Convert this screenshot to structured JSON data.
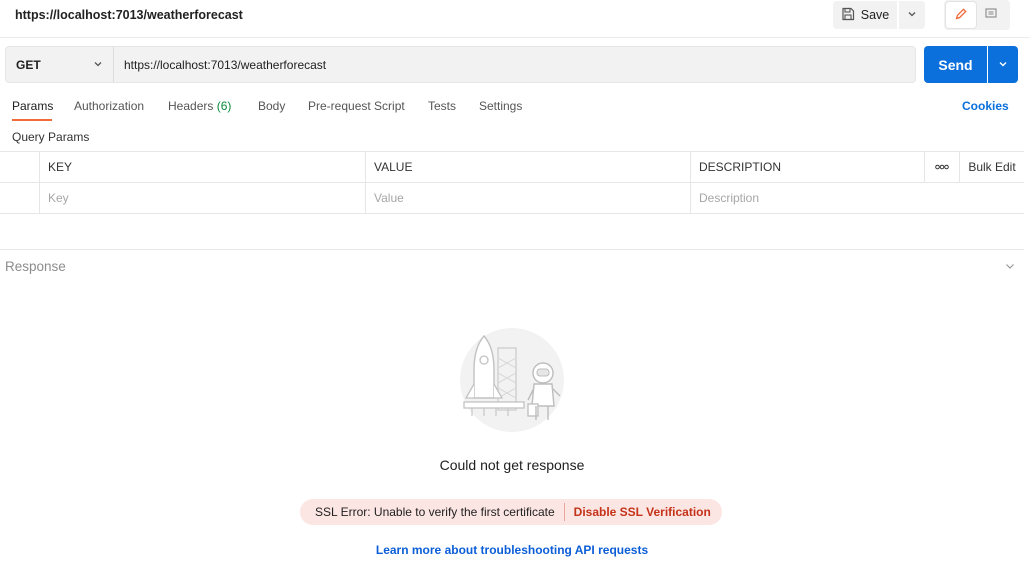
{
  "header": {
    "title": "https://localhost:7013/weatherforecast",
    "save_label": "Save"
  },
  "request": {
    "method": "GET",
    "url": "https://localhost:7013/weatherforecast",
    "send_label": "Send"
  },
  "tabs": {
    "params": "Params",
    "authorization": "Authorization",
    "headers": "Headers",
    "headers_count": "(6)",
    "body": "Body",
    "prerequest": "Pre-request Script",
    "tests": "Tests",
    "settings": "Settings",
    "cookies": "Cookies"
  },
  "params": {
    "section_label": "Query Params",
    "columns": {
      "key": "KEY",
      "value": "VALUE",
      "description": "DESCRIPTION",
      "more": "ooo",
      "bulk_edit": "Bulk Edit"
    },
    "placeholders": {
      "key": "Key",
      "value": "Value",
      "description": "Description"
    }
  },
  "response": {
    "title": "Response",
    "empty_message": "Could not get response",
    "error_text": "SSL Error: Unable to verify the first certificate",
    "disable_ssl_label": "Disable SSL Verification",
    "learn_more": "Learn more about troubleshooting API requests"
  },
  "colors": {
    "accent": "#f26b3a",
    "send": "#0b6fdc",
    "error_bg": "#fce6e3",
    "error_text": "#c4321a",
    "success": "#0a8a3b"
  },
  "icons": [
    "save-icon",
    "chevron-down-icon",
    "edit-pencil-icon",
    "comment-icon",
    "rocket-astronaut-illustration"
  ]
}
